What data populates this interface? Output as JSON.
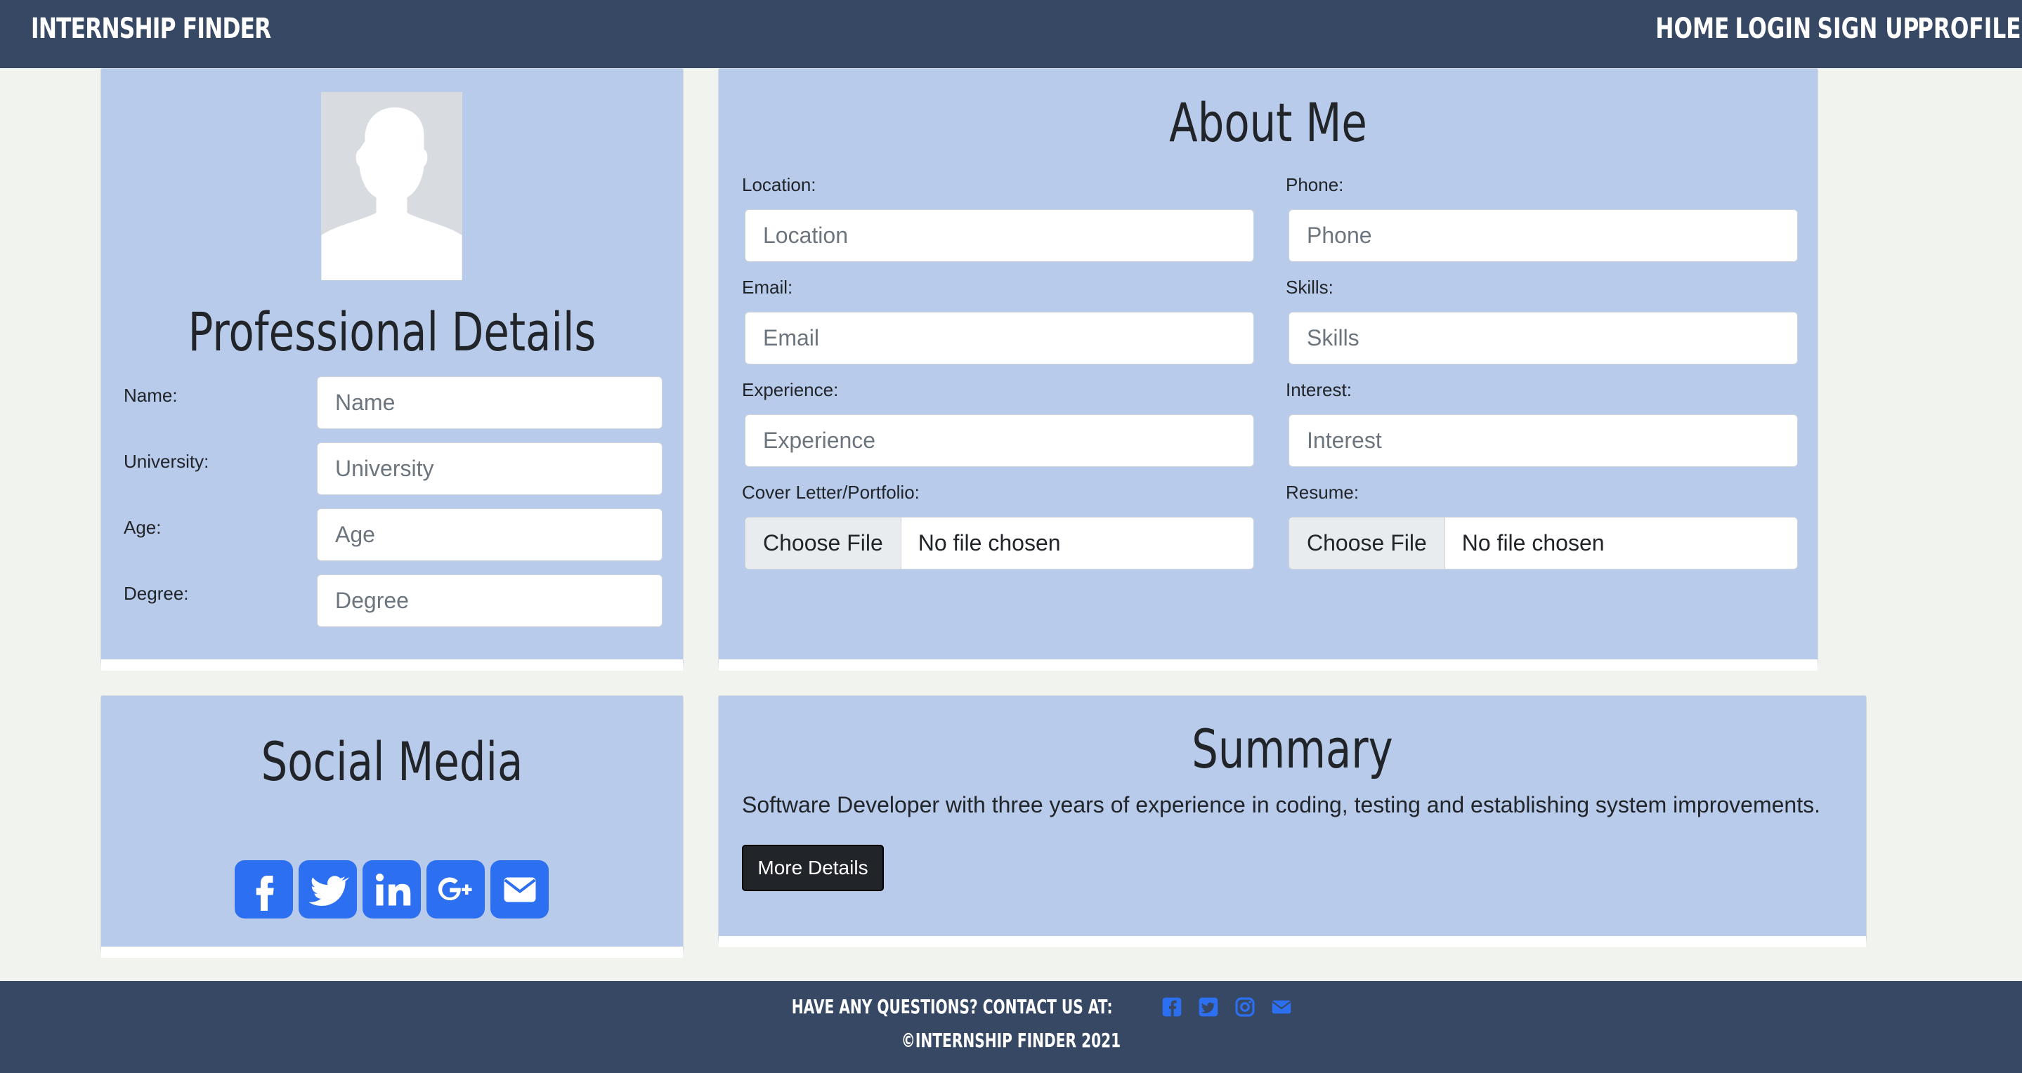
{
  "navbar": {
    "brand": "INTERNSHIP FINDER",
    "links": [
      "HOME",
      "LOGIN",
      "SIGN UP",
      "PROFILE"
    ]
  },
  "professional": {
    "title": "Professional Details",
    "fields": [
      {
        "label": "Name:",
        "placeholder": "Name"
      },
      {
        "label": "University:",
        "placeholder": "University"
      },
      {
        "label": "Age:",
        "placeholder": "Age"
      },
      {
        "label": "Degree:",
        "placeholder": "Degree"
      }
    ]
  },
  "about": {
    "title": "About Me",
    "location": {
      "label": "Location:",
      "placeholder": "Location"
    },
    "phone": {
      "label": "Phone:",
      "placeholder": "Phone"
    },
    "email": {
      "label": "Email:",
      "placeholder": "Email"
    },
    "skills": {
      "label": "Skills:",
      "placeholder": "Skills"
    },
    "experience": {
      "label": "Experience:",
      "placeholder": "Experience"
    },
    "interest": {
      "label": "Interest:",
      "placeholder": "Interest"
    },
    "cover": {
      "label": "Cover Letter/Portfolio:",
      "button": "Choose File",
      "status": "No file chosen"
    },
    "resume": {
      "label": "Resume:",
      "button": "Choose File",
      "status": "No file chosen"
    }
  },
  "social": {
    "title": "Social Media",
    "icons": [
      "facebook-icon",
      "twitter-icon",
      "linkedin-icon",
      "google-plus-icon",
      "envelope-icon"
    ]
  },
  "summary": {
    "title": "Summary",
    "text": "Software Developer with three years of experience in coding, testing and establishing system improvements.",
    "button": "More Details"
  },
  "footer": {
    "question": "HAVE ANY QUESTIONS? CONTACT US AT:",
    "icons": [
      "facebook-icon",
      "twitter-icon",
      "instagram-icon",
      "envelope-icon"
    ],
    "copyright": "©INTERNSHIP FINDER 2021"
  },
  "colors": {
    "navbar": "#374864",
    "card": "#b8cbea",
    "page": "#f1f3ee",
    "accent": "#2c6ff0",
    "button": "#212529"
  }
}
